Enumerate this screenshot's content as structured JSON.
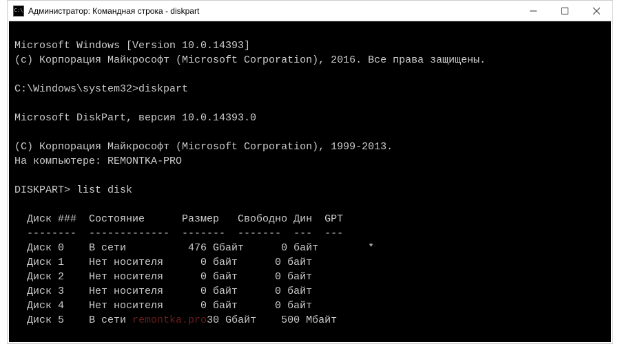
{
  "window": {
    "title": "Администратор: Командная строка - diskpart"
  },
  "terminal": {
    "line0": "Microsoft Windows [Version 10.0.14393]",
    "line1": "(c) Корпорация Майкрософт (Microsoft Corporation), 2016. Все права защищены.",
    "line2": "",
    "prompt1_path": "C:\\Windows\\system32>",
    "prompt1_cmd": "diskpart",
    "line_blank1": "",
    "dp_version": "Microsoft DiskPart, версия 10.0.14393.0",
    "line_blank2": "",
    "dp_copyright": "(C) Корпорация Майкрософт (Microsoft Corporation), 1999-2013.",
    "dp_computer": "На компьютере: REMONTKA-PRO",
    "line_blank3": "",
    "prompt2_path": "DISKPART> ",
    "prompt2_cmd": "list disk",
    "line_blank4": "",
    "header": "  Диск ###  Состояние      Размер   Свободно Дин  GPT",
    "divider": "  --------  -------------  -------  -------  ---  ---",
    "row0": "  Диск 0    В сети          476 Gбайт      0 байт        *",
    "row1": "  Диск 1    Нет носителя      0 байт      0 байт",
    "row2": "  Диск 2    Нет носителя      0 байт      0 байт",
    "row3": "  Диск 3    Нет носителя      0 байт      0 байт",
    "row4": "  Диск 4    Нет носителя      0 байт      0 байт",
    "row5_a": "  Диск 5    В сети ",
    "row5_wm": "remontka.pro",
    "row5_b": "30 Gбайт    500 Mбайт"
  },
  "chart_data": {
    "type": "table",
    "title": "DISKPART list disk",
    "columns": [
      "Диск ###",
      "Состояние",
      "Размер",
      "Свободно",
      "Дин",
      "GPT"
    ],
    "rows": [
      {
        "disk": "Диск 0",
        "status": "В сети",
        "size": "476 Gбайт",
        "free": "0 байт",
        "dyn": "",
        "gpt": "*"
      },
      {
        "disk": "Диск 1",
        "status": "Нет носителя",
        "size": "0 байт",
        "free": "0 байт",
        "dyn": "",
        "gpt": ""
      },
      {
        "disk": "Диск 2",
        "status": "Нет носителя",
        "size": "0 байт",
        "free": "0 байт",
        "dyn": "",
        "gpt": ""
      },
      {
        "disk": "Диск 3",
        "status": "Нет носителя",
        "size": "0 байт",
        "free": "0 байт",
        "dyn": "",
        "gpt": ""
      },
      {
        "disk": "Диск 4",
        "status": "Нет носителя",
        "size": "0 байт",
        "free": "0 байт",
        "dyn": "",
        "gpt": ""
      },
      {
        "disk": "Диск 5",
        "status": "В сети",
        "size": "30 Gбайт",
        "free": "500 Mбайт",
        "dyn": "",
        "gpt": ""
      }
    ]
  }
}
